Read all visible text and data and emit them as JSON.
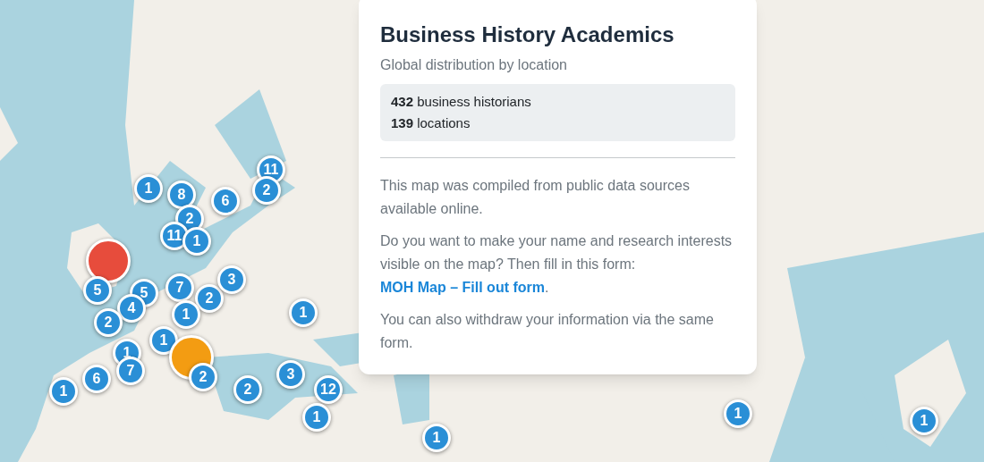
{
  "panel": {
    "title": "Business History Academics",
    "subtitle": "Global distribution by location",
    "stats": [
      "**432** business historians",
      "**139** locations"
    ],
    "paragraphs": [
      {
        "text": "This map was compiled from public data sources available online."
      },
      {
        "text": "Do you want to make your name and research interests visible on the map? Then fill in this form:",
        "link": "MOH Map – Fill out form",
        "after": "."
      },
      {
        "text": "You can also withdraw your information via the same form."
      }
    ]
  },
  "markers": [
    {
      "kind": "single",
      "count": "11",
      "color": "#2a8fd6"
    },
    {
      "kind": "single",
      "count": "1",
      "color": "#2a8fd6"
    },
    {
      "kind": "single",
      "count": "8",
      "color": "#2a8fd6"
    },
    {
      "kind": "single",
      "count": "6",
      "color": "#2a8fd6"
    },
    {
      "kind": "single",
      "count": "2",
      "color": "#2a8fd6"
    },
    {
      "kind": "single",
      "count": "2",
      "color": "#2a8fd6"
    },
    {
      "kind": "single",
      "count": "11",
      "color": "#2a8fd6"
    },
    {
      "kind": "single",
      "count": "1",
      "color": "#2a8fd6"
    },
    {
      "kind": "big",
      "color": "#e74c3c"
    },
    {
      "kind": "single",
      "count": "5",
      "color": "#2a8fd6"
    },
    {
      "kind": "single",
      "count": "5",
      "color": "#2a8fd6"
    },
    {
      "kind": "single",
      "count": "7",
      "color": "#2a8fd6"
    },
    {
      "kind": "single",
      "count": "2",
      "color": "#2a8fd6"
    },
    {
      "kind": "single",
      "count": "3",
      "color": "#2a8fd6"
    },
    {
      "kind": "single",
      "count": "4",
      "color": "#2a8fd6"
    },
    {
      "kind": "single",
      "count": "1",
      "color": "#2a8fd6"
    },
    {
      "kind": "single",
      "count": "1",
      "color": "#2a8fd6"
    },
    {
      "kind": "single",
      "count": "2",
      "color": "#2a8fd6"
    },
    {
      "kind": "single",
      "count": "1",
      "color": "#2a8fd6"
    },
    {
      "kind": "single",
      "count": "1",
      "color": "#2a8fd6"
    },
    {
      "kind": "big",
      "color": "#f39c12"
    },
    {
      "kind": "single",
      "count": "1",
      "color": "#2a8fd6"
    },
    {
      "kind": "single",
      "count": "6",
      "color": "#2a8fd6"
    },
    {
      "kind": "single",
      "count": "7",
      "color": "#2a8fd6"
    },
    {
      "kind": "single",
      "count": "2",
      "color": "#2a8fd6"
    },
    {
      "kind": "single",
      "count": "2",
      "color": "#2a8fd6"
    },
    {
      "kind": "single",
      "count": "3",
      "color": "#2a8fd6"
    },
    {
      "kind": "single",
      "count": "12",
      "color": "#2a8fd6"
    },
    {
      "kind": "single",
      "count": "1",
      "color": "#2a8fd6"
    },
    {
      "kind": "single",
      "count": "1",
      "color": "#2a8fd6"
    },
    {
      "kind": "single",
      "count": "1",
      "color": "#2a8fd6"
    },
    {
      "kind": "single",
      "count": "1",
      "color": "#2a8fd6"
    }
  ]
}
